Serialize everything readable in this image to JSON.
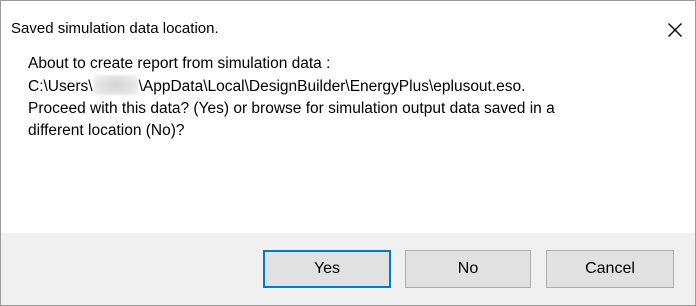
{
  "dialog": {
    "title": "Saved simulation data location.",
    "close_icon": "close-icon",
    "message": {
      "line1": "About to create report from simulation data :",
      "line2_prefix": "C:\\Users\\",
      "line2_suffix": "\\AppData\\Local\\DesignBuilder\\EnergyPlus\\eplusout.eso.",
      "line3": "Proceed with this data? (Yes) or browse for simulation output data saved in a",
      "line4": "different location (No)?"
    },
    "buttons": {
      "yes": "Yes",
      "no": "No",
      "cancel": "Cancel"
    },
    "colors": {
      "footer_background": "#f0f0f0",
      "button_background": "#e1e1e1",
      "default_button_border": "#0078d7"
    }
  }
}
